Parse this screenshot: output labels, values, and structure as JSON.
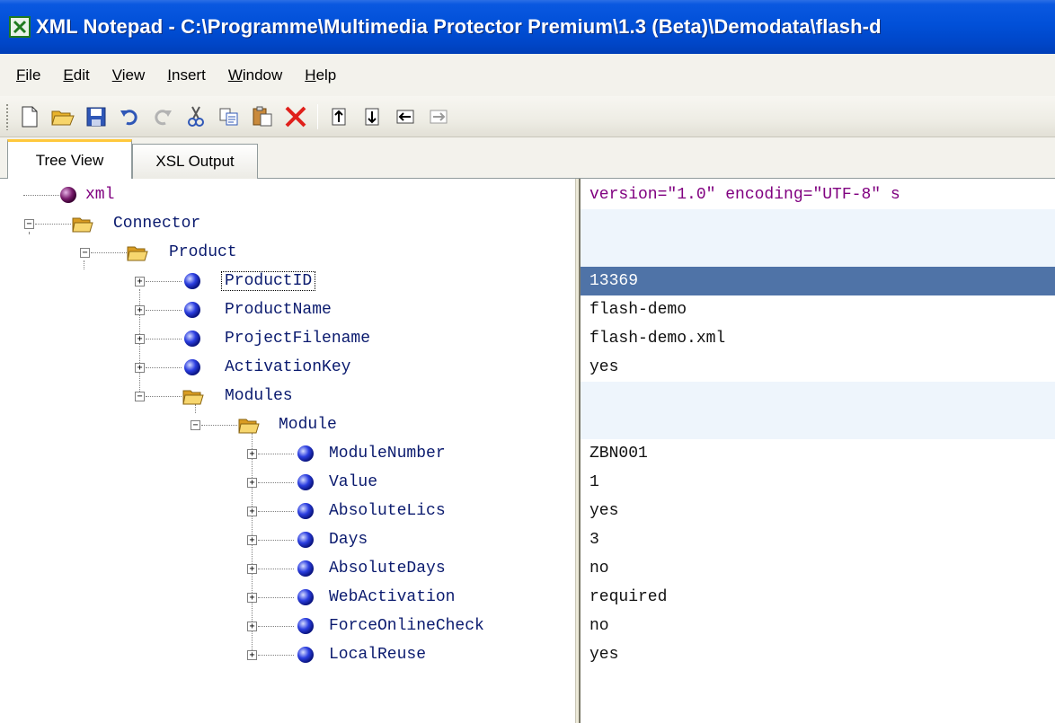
{
  "window": {
    "title": "XML Notepad - C:\\Programme\\Multimedia Protector Premium\\1.3 (Beta)\\Demodata\\flash-d",
    "app_icon": "excel-like-x-icon"
  },
  "menu": [
    {
      "label": "File",
      "underline": "F",
      "rest": "ile"
    },
    {
      "label": "Edit",
      "underline": "E",
      "rest": "dit"
    },
    {
      "label": "View",
      "underline": "V",
      "rest": "iew"
    },
    {
      "label": "Insert",
      "underline": "I",
      "rest": "nsert"
    },
    {
      "label": "Window",
      "underline": "W",
      "rest": "indow"
    },
    {
      "label": "Help",
      "underline": "H",
      "rest": "elp"
    }
  ],
  "toolbar": {
    "buttons": [
      "new-icon",
      "open-icon",
      "save-icon",
      "undo-icon",
      "redo-icon",
      "cut-icon",
      "copy-icon",
      "paste-icon",
      "delete-icon",
      "nudge-up-icon",
      "nudge-down-icon",
      "nudge-left-icon",
      "nudge-right-icon"
    ]
  },
  "tabs": [
    {
      "label": "Tree View",
      "active": true
    },
    {
      "label": "XSL Output",
      "active": false
    }
  ],
  "tree": [
    {
      "label": "xml",
      "kind": "pi",
      "value": "version=\"1.0\" encoding=\"UTF-8\" s"
    },
    {
      "label": "Connector",
      "kind": "folder",
      "value": ""
    },
    {
      "label": "Product",
      "kind": "folder",
      "value": ""
    },
    {
      "label": "ProductID",
      "kind": "element",
      "value": "13369",
      "selected": true
    },
    {
      "label": "ProductName",
      "kind": "element",
      "value": "flash-demo"
    },
    {
      "label": "ProjectFilename",
      "kind": "element",
      "value": "flash-demo.xml"
    },
    {
      "label": "ActivationKey",
      "kind": "element",
      "value": "yes"
    },
    {
      "label": "Modules",
      "kind": "folder",
      "value": ""
    },
    {
      "label": "Module",
      "kind": "folder",
      "value": ""
    },
    {
      "label": "ModuleNumber",
      "kind": "element",
      "value": "ZBN001"
    },
    {
      "label": "Value",
      "kind": "element",
      "value": "1"
    },
    {
      "label": "AbsoluteLics",
      "kind": "element",
      "value": "yes"
    },
    {
      "label": "Days",
      "kind": "element",
      "value": "3"
    },
    {
      "label": "AbsoluteDays",
      "kind": "element",
      "value": "no"
    },
    {
      "label": "WebActivation",
      "kind": "element",
      "value": "required"
    },
    {
      "label": "ForceOnlineCheck",
      "kind": "element",
      "value": "no"
    },
    {
      "label": "LocalReuse",
      "kind": "element",
      "value": "yes"
    }
  ],
  "colors": {
    "titlebar": "#0150d8",
    "selection": "#4f73a7",
    "pi_text": "#800080",
    "element_text": "#0a1a6e",
    "folder_row_tint": "#eef5fc"
  }
}
